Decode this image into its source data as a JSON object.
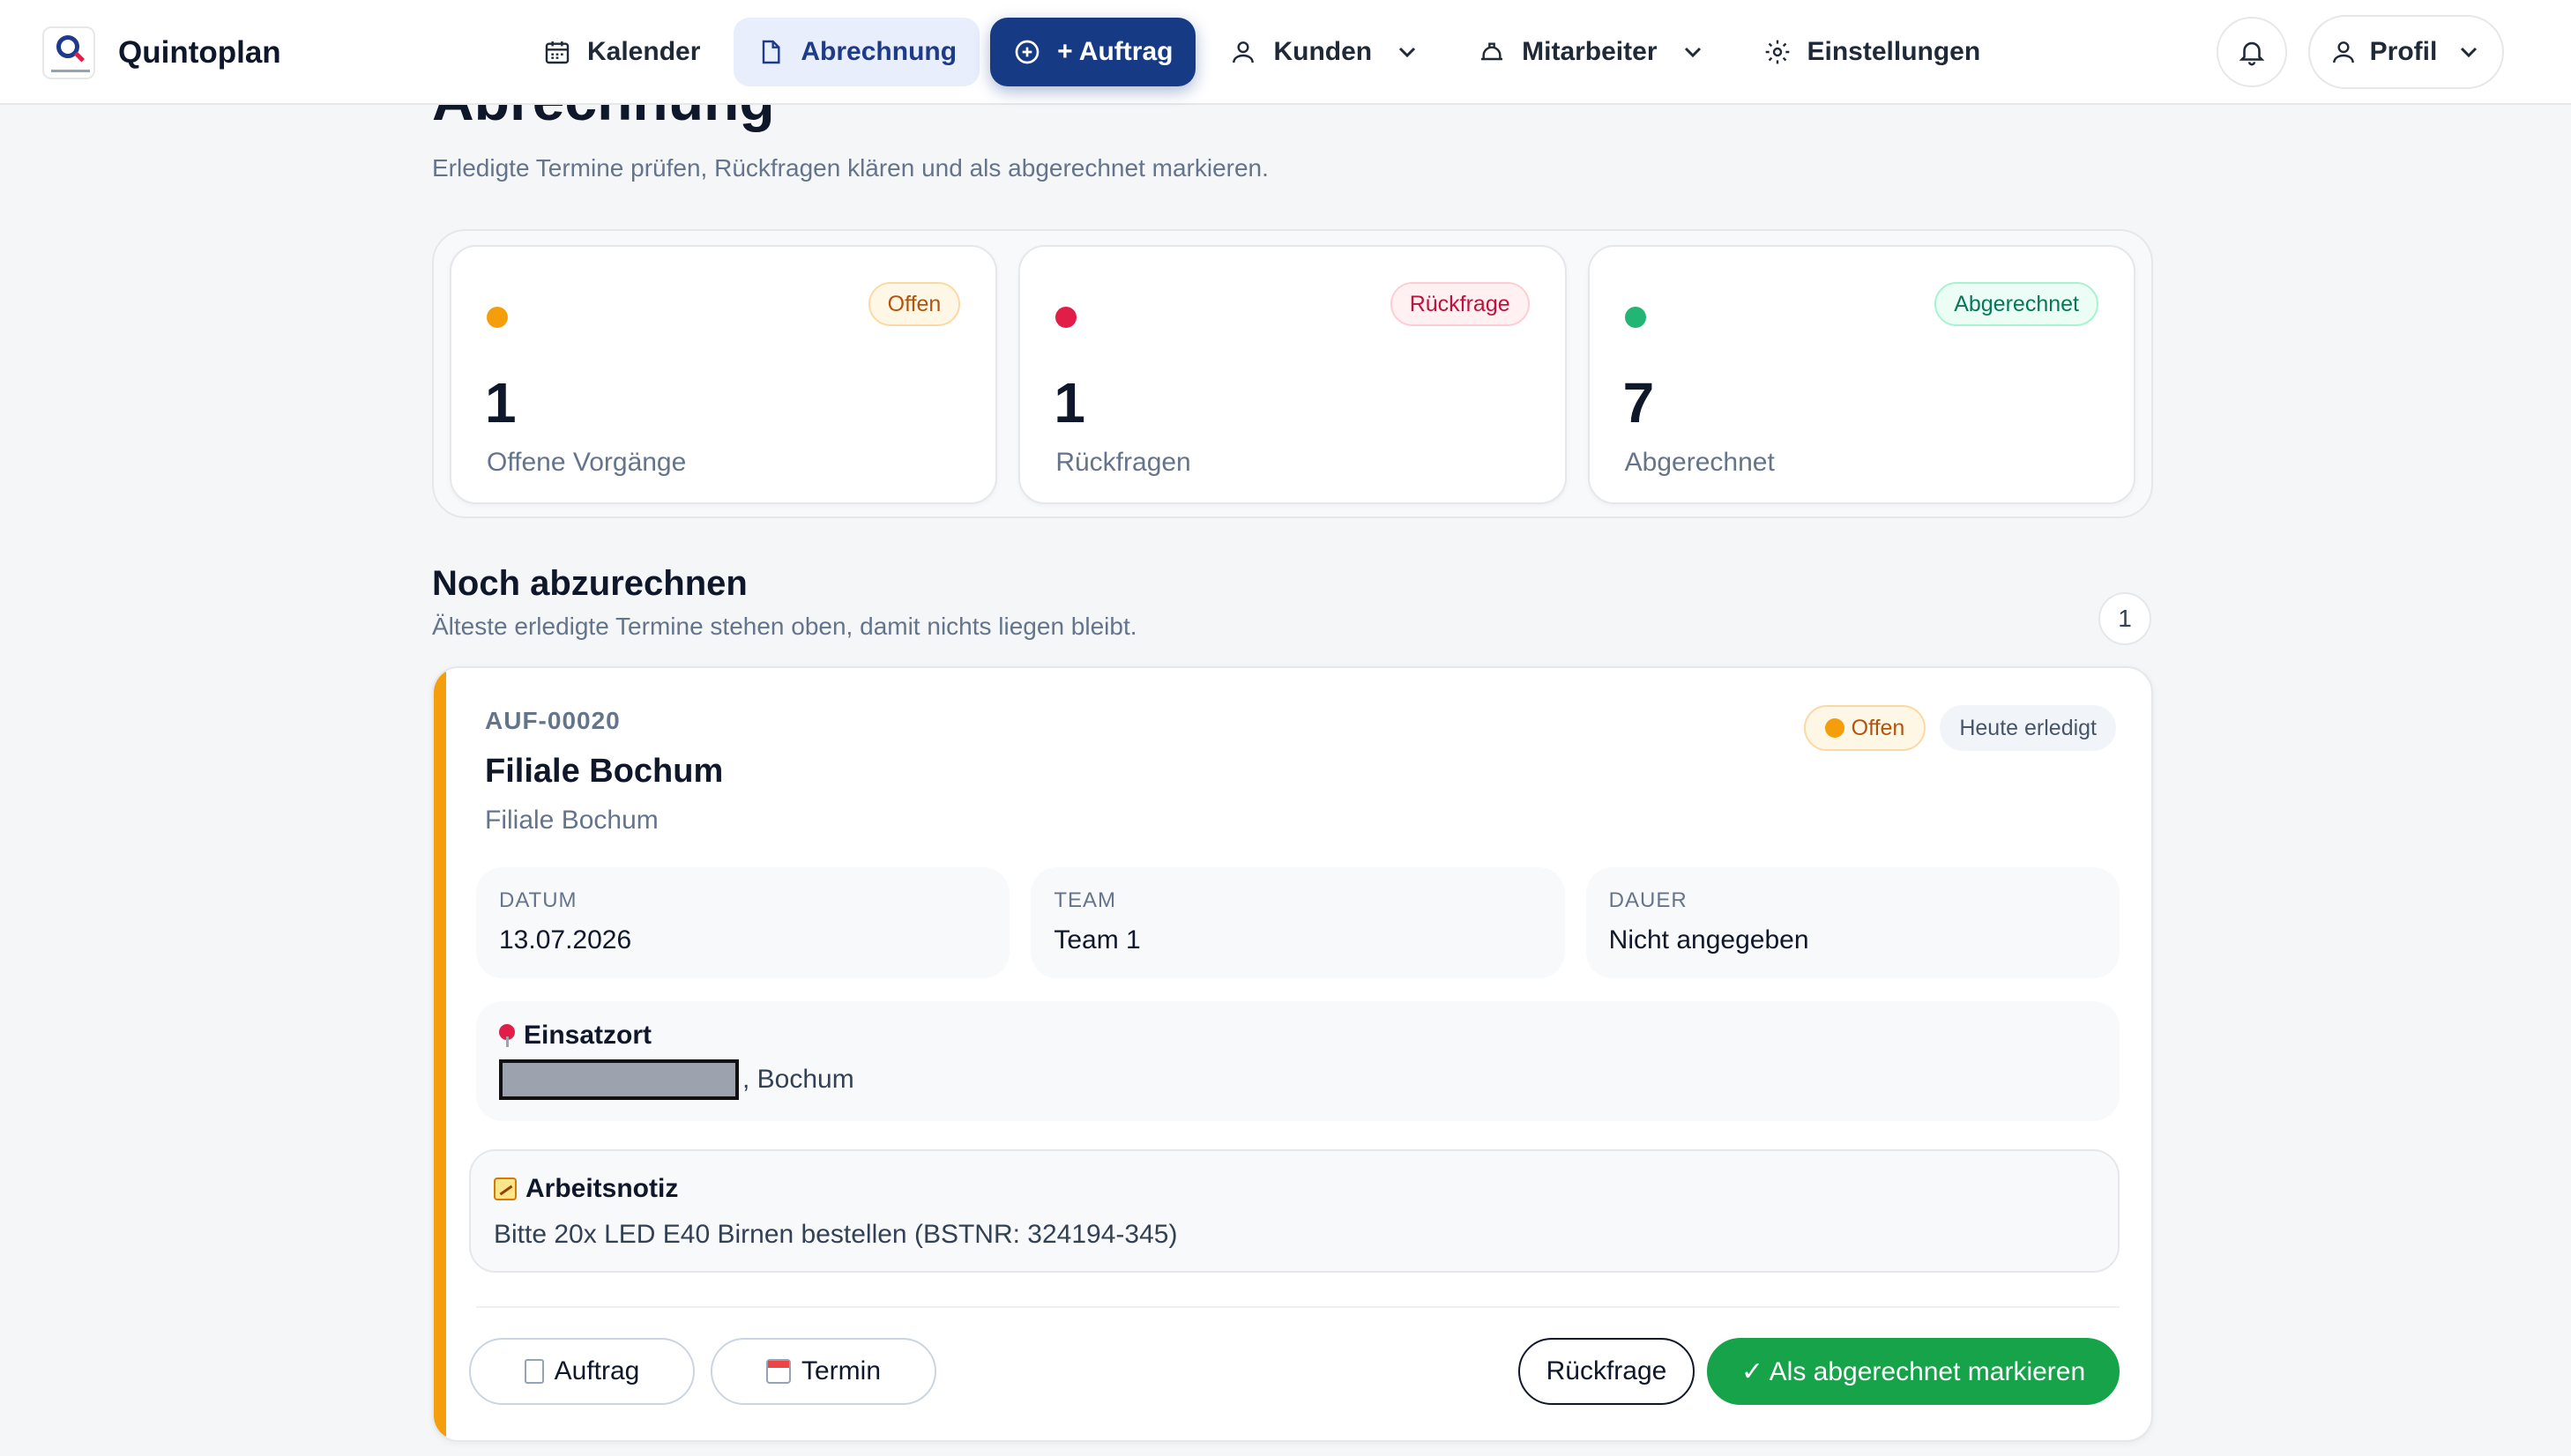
{
  "brand": {
    "name": "Quintoplan"
  },
  "nav": {
    "kalender": "Kalender",
    "abrechnung": "Abrechnung",
    "auftrag": "+ Auftrag",
    "kunden": "Kunden",
    "mitarbeiter": "Mitarbeiter",
    "einstellungen": "Einstellungen",
    "active": "Abrechnung"
  },
  "header": {
    "profile_label": "Profil"
  },
  "page": {
    "title": "Abrechnung",
    "subtitle": "Erledigte Termine prüfen, Rückfragen klären und als abgerechnet markieren."
  },
  "stats": [
    {
      "badge": "Offen",
      "value": "1",
      "label": "Offene Vorgänge",
      "color": "#f59e0b"
    },
    {
      "badge": "Rückfrage",
      "value": "1",
      "label": "Rückfragen",
      "color": "#e11d48"
    },
    {
      "badge": "Abgerechnet",
      "value": "7",
      "label": "Abgerechnet",
      "color": "#22b573"
    }
  ],
  "section": {
    "title": "Noch abzurechnen",
    "subtitle": "Älteste erledigte Termine stehen oben, damit nichts liegen bleibt.",
    "count": "1"
  },
  "card": {
    "code": "AUF-00020",
    "title": "Filiale Bochum",
    "subtitle": "Filiale Bochum",
    "status_badge": "Offen",
    "done_badge": "Heute erledigt",
    "accent_color": "#f59e0b",
    "info": [
      {
        "key": "DATUM",
        "value": "13.07.2026"
      },
      {
        "key": "TEAM",
        "value": "Team 1"
      },
      {
        "key": "DAUER",
        "value": "Nicht angegeben"
      }
    ],
    "location": {
      "label": "Einsatzort",
      "address_suffix": ", Bochum"
    },
    "note": {
      "label": "Arbeitsnotiz",
      "text": "Bitte 20x LED E40 Birnen bestellen (BSTNR: 324194-345)"
    },
    "actions": {
      "auftrag": "Auftrag",
      "termin": "Termin",
      "rueckfrage": "Rückfrage",
      "done": "✓ Als abgerechnet markieren"
    }
  }
}
